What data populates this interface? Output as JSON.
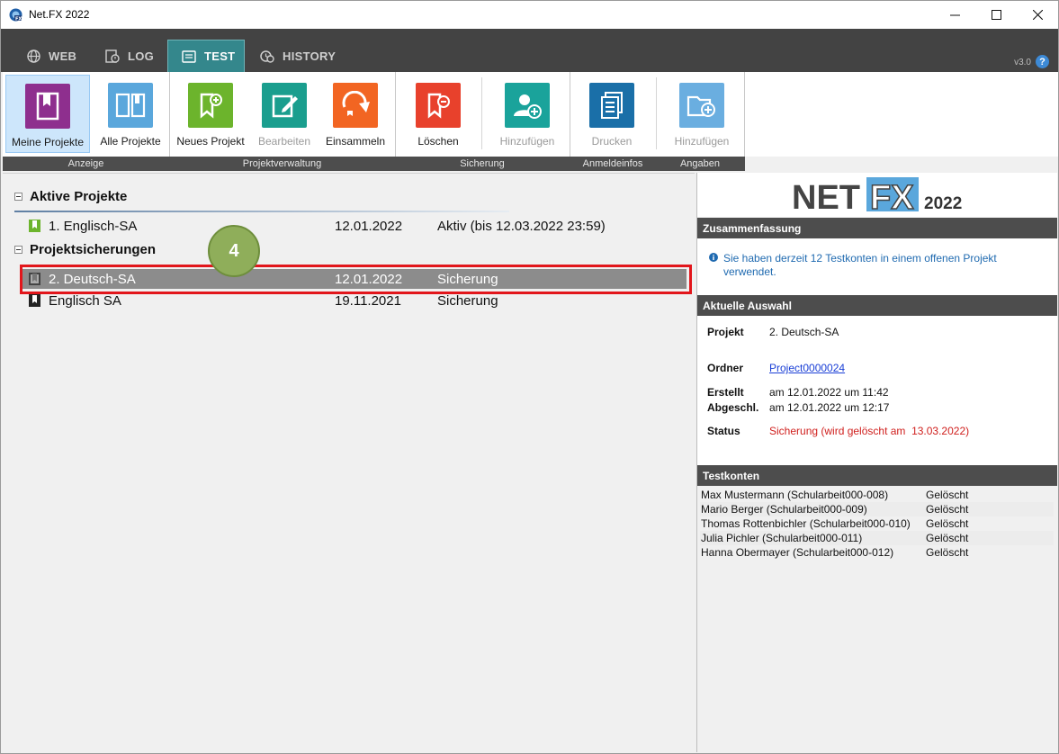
{
  "window": {
    "title": "Net.FX 2022",
    "minimize_glyph": "─",
    "maximize_glyph": "☐",
    "close_glyph": "✕"
  },
  "tabs": [
    {
      "label": "WEB",
      "icon": "globe-icon",
      "active": false
    },
    {
      "label": "LOG",
      "icon": "log-icon",
      "active": false
    },
    {
      "label": "TEST",
      "icon": "test-icon",
      "active": true
    },
    {
      "label": "HISTORY",
      "icon": "history-icon",
      "active": false
    }
  ],
  "version": "v3.0",
  "help_glyph": "?",
  "ribbon": {
    "buttons": [
      {
        "label": "Meine Projekte",
        "icon": "my-projects-icon",
        "color": "#8e2f8e",
        "selected": true,
        "enabled": true
      },
      {
        "label": "Alle Projekte",
        "icon": "all-projects-icon",
        "color": "#5aa7dc",
        "selected": false,
        "enabled": true
      },
      {
        "label": "Neues Projekt",
        "icon": "new-project-icon",
        "color": "#6cb42c",
        "selected": false,
        "enabled": true
      },
      {
        "label": "Bearbeiten",
        "icon": "edit-icon",
        "color": "#1a9e8e",
        "selected": false,
        "enabled": false
      },
      {
        "label": "Einsammeln",
        "icon": "collect-icon",
        "color": "#f26522",
        "selected": false,
        "enabled": true
      },
      {
        "label": "Löschen",
        "icon": "delete-icon",
        "color": "#e8412c",
        "selected": false,
        "enabled": true
      },
      {
        "label": "Hinzufügen",
        "icon": "add-user-icon",
        "color": "#1aa39b",
        "selected": false,
        "enabled": false
      },
      {
        "label": "Drucken",
        "icon": "print-icon",
        "color": "#1a6fa8",
        "selected": false,
        "enabled": false
      },
      {
        "label": "Hinzufügen",
        "icon": "add-folder-icon",
        "color": "#6aaee0",
        "selected": false,
        "enabled": false
      }
    ],
    "groups": [
      "Anzeige",
      "Projektverwaltung",
      "Sicherung",
      "Anmeldeinfos",
      "Angaben"
    ]
  },
  "tree": {
    "active_header": "Aktive Projekte",
    "active_items": [
      {
        "name": "1. Englisch-SA",
        "date": "12.01.2022",
        "status": "Aktiv (bis 12.03.2022 23:59)",
        "color": "#6cb42c"
      }
    ],
    "backup_header": "Projektsicherungen",
    "backup_items": [
      {
        "name": "2. Deutsch-SA",
        "date": "12.01.2022",
        "status": "Sicherung",
        "color": "#555555",
        "selected": true
      },
      {
        "name": "Englisch SA",
        "date": "19.11.2021",
        "status": "Sicherung",
        "color": "#222222",
        "selected": false
      }
    ],
    "step_badge": "4"
  },
  "details": {
    "logo": {
      "net": "NET",
      "fx": "FX",
      "year": "2022"
    },
    "summary_title": "Zusammenfassung",
    "summary_text_1": "Sie haben derzeit 12 Testkonten in einem offenen Projekt",
    "summary_text_2": "verwendet.",
    "selection_title": "Aktuelle Auswahl",
    "projekt_label": "Projekt",
    "projekt_value": "2. Deutsch-SA",
    "ordner_label": "Ordner",
    "ordner_value": "Project0000024",
    "erstellt_label": "Erstellt",
    "erstellt_value": "am 12.01.2022 um 11:42",
    "abgeschl_label": "Abgeschl.",
    "abgeschl_value": "am 12.01.2022 um 12:17",
    "status_label": "Status",
    "status_value": "Sicherung (wird gelöscht am  13.03.2022)",
    "testkonten_title": "Testkonten",
    "testkonten": [
      {
        "name": "Max Mustermann (Schularbeit000-008)",
        "state": "Gelöscht"
      },
      {
        "name": "Mario Berger (Schularbeit000-009)",
        "state": "Gelöscht"
      },
      {
        "name": "Thomas Rottenbichler (Schularbeit000-010)",
        "state": "Gelöscht"
      },
      {
        "name": "Julia Pichler (Schularbeit000-011)",
        "state": "Gelöscht"
      },
      {
        "name": "Hanna Obermayer (Schularbeit000-012)",
        "state": "Gelöscht"
      }
    ]
  },
  "colors": {
    "accent_tab": "#34878c",
    "highlight": "#e2161b",
    "status_red": "#d0201e",
    "link_blue": "#1a3fd6",
    "info_blue": "#1f6ab0"
  }
}
